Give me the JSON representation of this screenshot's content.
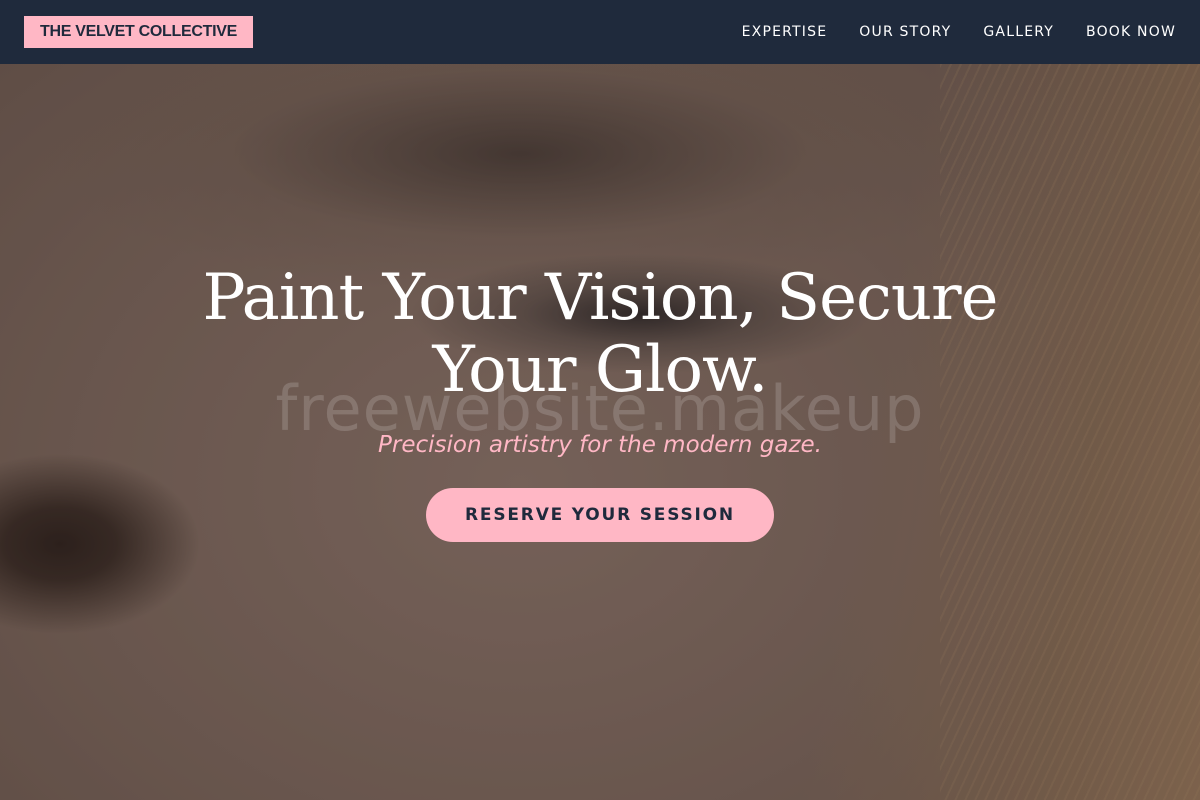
{
  "brand": {
    "name": "THE VELVET COLLECTIVE"
  },
  "nav": {
    "links": [
      {
        "label": "EXPERTISE"
      },
      {
        "label": "OUR STORY"
      },
      {
        "label": "GALLERY"
      },
      {
        "label": "BOOK NOW"
      }
    ]
  },
  "hero": {
    "title": "Paint Your Vision, Secure Your Glow.",
    "watermark": "freewebsite.makeup",
    "subtitle": "Precision artistry for the modern gaze.",
    "cta_label": "RESERVE YOUR SESSION"
  },
  "colors": {
    "navbar": "#1f2a3c",
    "accent_pink": "#ffb7c5",
    "text_light": "#ffffff"
  }
}
